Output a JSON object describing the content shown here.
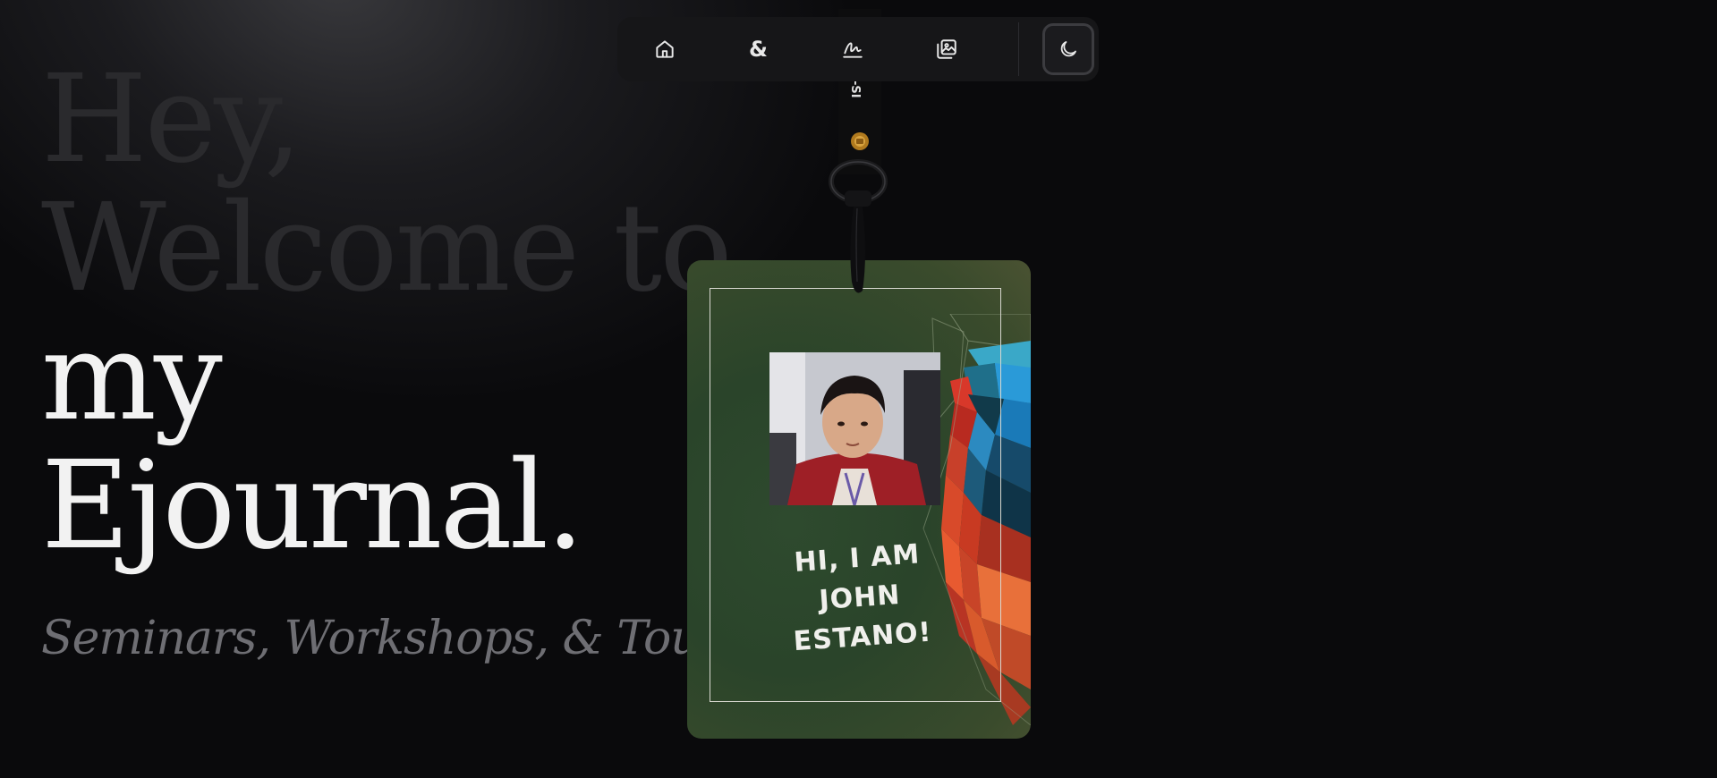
{
  "hero": {
    "line1": "Hey,",
    "line2": "Welcome to",
    "line3": "my",
    "line4": "Ejournal."
  },
  "subtitle": "Seminars, Workshops, & Tours",
  "nav": {
    "items": [
      {
        "name": "home",
        "icon": "home-icon"
      },
      {
        "name": "ampersand",
        "icon": "ampersand-icon",
        "glyph": "&"
      },
      {
        "name": "signature",
        "icon": "signature-icon"
      },
      {
        "name": "gallery",
        "icon": "image-gallery-icon"
      }
    ],
    "theme_toggle": {
      "icon": "moon-icon"
    }
  },
  "lanyard": {
    "strap_text": "-SI"
  },
  "badge": {
    "greeting_line1": "HI, I AM",
    "greeting_line2": "JOHN",
    "greeting_line3": "ESTANO!",
    "frame_color": "#d8d8d0",
    "background_color": "#2e4a2e"
  }
}
